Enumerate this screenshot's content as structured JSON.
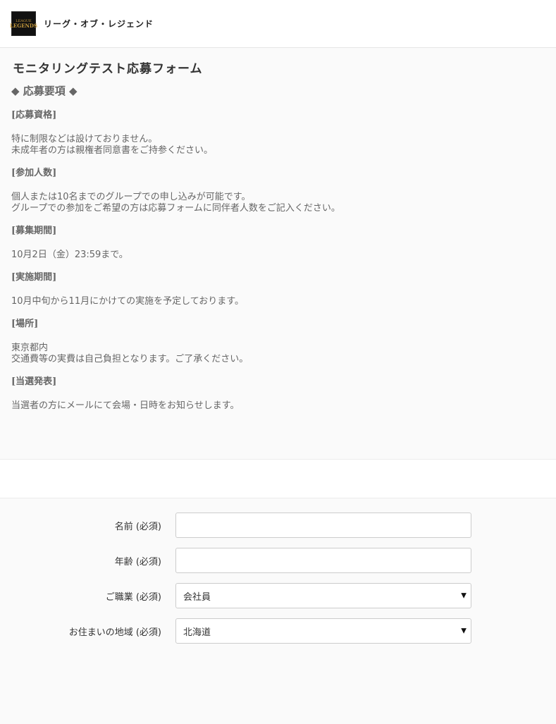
{
  "header": {
    "logo_line1": "LEAGUE",
    "logo_line2": "LEGENDS",
    "brand": "リーグ・オブ・レジェンド"
  },
  "info": {
    "form_title": "モニタリングテスト応募フォーム",
    "section_title": "◆ 応募要項 ◆",
    "sections": [
      {
        "heading": "[応募資格]",
        "lines": [
          "特に制限などは設けておりません。",
          "未成年者の方は親権者同意書をご持参ください。"
        ]
      },
      {
        "heading": "[参加人数]",
        "lines": [
          "個人または10名までのグループでの申し込みが可能です。",
          "グループでの参加をご希望の方は応募フォームに同伴者人数をご記入ください。"
        ]
      },
      {
        "heading": "[募集期間]",
        "lines": [
          "10月2日（金）23:59まで。"
        ]
      },
      {
        "heading": "[実施期間]",
        "lines": [
          "10月中旬から11月にかけての実施を予定しております。"
        ]
      },
      {
        "heading": "[場所]",
        "lines": [
          "東京都内",
          "交通費等の実費は自己負担となります。ご了承ください。"
        ]
      },
      {
        "heading": "[当選発表]",
        "lines": [
          "当選者の方にメールにて会場・日時をお知らせします。"
        ]
      }
    ]
  },
  "form": {
    "name_label": "名前 (必須)",
    "name_value": "",
    "age_label": "年齢 (必須)",
    "age_value": "",
    "occupation_label": "ご職業 (必須)",
    "occupation_value": "会社員",
    "region_label": "お住まいの地域 (必須)",
    "region_value": "北海道"
  }
}
